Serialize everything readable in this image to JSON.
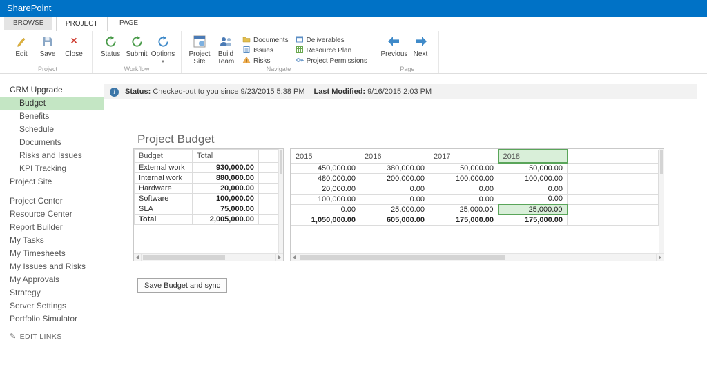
{
  "suite_bar": {
    "brand": "SharePoint"
  },
  "ribbon": {
    "tabs": [
      {
        "label": "BROWSE"
      },
      {
        "label": "PROJECT"
      },
      {
        "label": "PAGE"
      }
    ],
    "groups": {
      "project": {
        "label": "Project",
        "buttons": {
          "edit": "Edit",
          "save": "Save",
          "close": "Close"
        }
      },
      "workflow": {
        "label": "Workflow",
        "buttons": {
          "status": "Status",
          "submit": "Submit",
          "options": "Options"
        }
      },
      "navigate": {
        "label": "Navigate",
        "big": {
          "project_site": "Project Site",
          "build_team": "Build Team"
        },
        "small": {
          "documents": "Documents",
          "issues": "Issues",
          "risks": "Risks",
          "deliverables": "Deliverables",
          "resource_plan": "Resource Plan",
          "project_permissions": "Project Permissions"
        }
      },
      "page": {
        "label": "Page",
        "buttons": {
          "previous": "Previous",
          "next": "Next"
        }
      }
    }
  },
  "sidebar": {
    "project_name": "CRM Upgrade",
    "project_items": [
      "Budget",
      "Benefits",
      "Schedule",
      "Documents",
      "Risks and Issues",
      "KPI Tracking"
    ],
    "selected": "Budget",
    "site_link": "Project Site",
    "links": [
      "Project Center",
      "Resource Center",
      "Report Builder",
      "My Tasks",
      "My Timesheets",
      "My Issues and Risks",
      "My Approvals",
      "Strategy",
      "Server Settings",
      "Portfolio Simulator"
    ],
    "edit_links": "EDIT LINKS"
  },
  "status_bar": {
    "status_label": "Status:",
    "status_value": "Checked-out to you since 9/23/2015 5:38 PM",
    "modified_label": "Last Modified:",
    "modified_value": "9/16/2015 2:03 PM"
  },
  "main": {
    "title": "Project Budget",
    "save_button": "Save Budget and sync"
  },
  "budget_table": {
    "left_headers": [
      "Budget",
      "Total"
    ],
    "year_headers": [
      "2015",
      "2016",
      "2017",
      "2018"
    ],
    "selected_year": "2018",
    "selected_cell": {
      "row": "SLA",
      "year": "2018"
    },
    "rows": [
      {
        "label": "External work",
        "total": "930,000.00",
        "years": [
          "450,000.00",
          "380,000.00",
          "50,000.00",
          "50,000.00"
        ]
      },
      {
        "label": "Internal work",
        "total": "880,000.00",
        "years": [
          "480,000.00",
          "200,000.00",
          "100,000.00",
          "100,000.00"
        ]
      },
      {
        "label": "Hardware",
        "total": "20,000.00",
        "years": [
          "20,000.00",
          "0.00",
          "0.00",
          "0.00"
        ]
      },
      {
        "label": "Software",
        "total": "100,000.00",
        "years": [
          "100,000.00",
          "0.00",
          "0.00",
          "0.00"
        ]
      },
      {
        "label": "SLA",
        "total": "75,000.00",
        "years": [
          "0.00",
          "25,000.00",
          "25,000.00",
          "25,000.00"
        ]
      },
      {
        "label": "Total",
        "total": "2,005,000.00",
        "years": [
          "1,050,000.00",
          "605,000.00",
          "175,000.00",
          "175,000.00"
        ],
        "is_total": true
      }
    ]
  },
  "colors": {
    "suite_blue": "#0072c6",
    "selection_green": "#5aa55a",
    "selection_green_bg": "#d9efd9",
    "sidebar_highlight": "#c4e6c4"
  }
}
